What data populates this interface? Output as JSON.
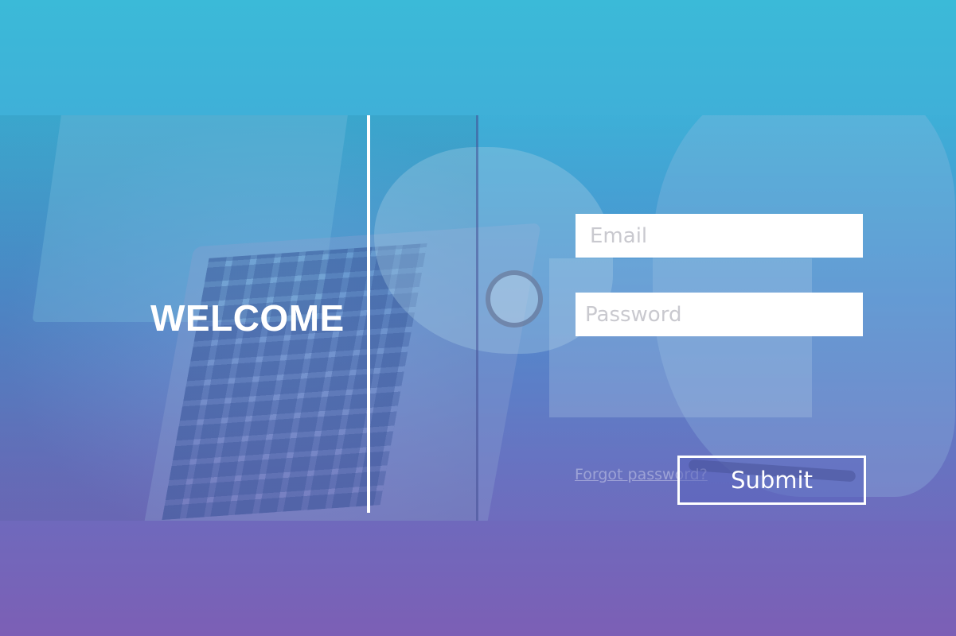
{
  "welcome": {
    "heading": "WELCOME"
  },
  "login_form": {
    "email_placeholder": "Email",
    "password_placeholder": "Password",
    "forgot_password_link": "Forgot password?",
    "submit_label": "Submit"
  },
  "colors": {
    "gradient_top": "#3bbad8",
    "gradient_bottom": "#7c5fb5",
    "text_light": "#ffffff",
    "field_background": "#ffffff",
    "placeholder": "#c9c9cf"
  }
}
